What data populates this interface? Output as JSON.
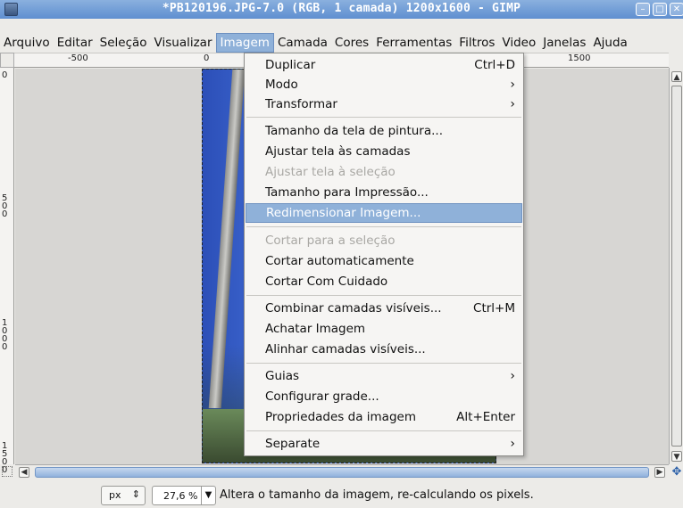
{
  "window": {
    "title": "*PB120196.JPG-7.0 (RGB, 1 camada) 1200x1600 - GIMP",
    "btn_min": "–",
    "btn_max": "□",
    "btn_close": "✕"
  },
  "menubar": {
    "items": [
      "Arquivo",
      "Editar",
      "Seleção",
      "Visualizar",
      "Imagem",
      "Camada",
      "Cores",
      "Ferramentas",
      "Filtros",
      "Video",
      "Janelas",
      "Ajuda"
    ],
    "active": "Imagem"
  },
  "ruler": {
    "h_labels": [
      "-500",
      "0",
      "1500"
    ],
    "v_labels": [
      "0",
      "500",
      "1000",
      "1500"
    ]
  },
  "image_menu": {
    "duplicate": {
      "label": "Duplicar",
      "shortcut": "Ctrl+D"
    },
    "mode": {
      "label": "Modo"
    },
    "transform": {
      "label": "Transformar"
    },
    "canvas_size": {
      "label": "Tamanho da tela de pintura..."
    },
    "fit_canvas_layers": {
      "label": "Ajustar tela às camadas"
    },
    "fit_canvas_selection": {
      "label": "Ajustar tela à seleção",
      "disabled": true
    },
    "print_size": {
      "label": "Tamanho para  Impressão..."
    },
    "scale_image": {
      "label": "Redimensionar Imagem...",
      "highlighted": true
    },
    "crop_selection": {
      "label": "Cortar para a seleção",
      "disabled": true
    },
    "autocrop": {
      "label": "Cortar automaticamente"
    },
    "zealous_crop": {
      "label": "Cortar Com Cuidado"
    },
    "merge_visible": {
      "label": "Combinar camadas visíveis...",
      "shortcut": "Ctrl+M"
    },
    "flatten": {
      "label": "Achatar Imagem"
    },
    "align_layers": {
      "label": "Alinhar camadas visíveis..."
    },
    "guides": {
      "label": "Guias"
    },
    "configure_grid": {
      "label": "Configurar grade..."
    },
    "properties": {
      "label": "Propriedades da imagem",
      "shortcut": "Alt+Enter"
    },
    "separate": {
      "label": "Separate"
    }
  },
  "statusbar": {
    "unit": "px",
    "zoom": "27,6 %",
    "message": "Altera o tamanho da imagem, re-calculando os pixels."
  },
  "colors": {
    "highlight": "#8fb1d9",
    "titlebar": "#6f9ad4"
  }
}
